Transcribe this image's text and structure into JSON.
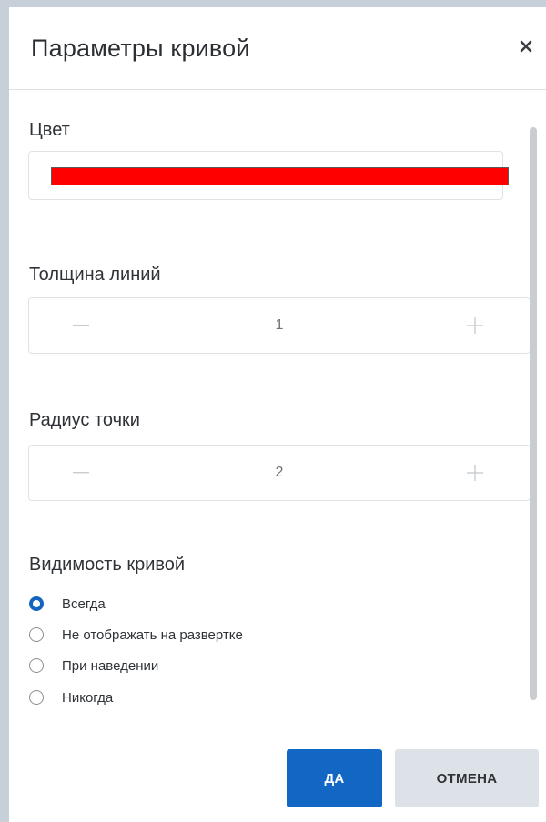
{
  "dialog": {
    "title": "Параметры кривой",
    "close_icon": "close-icon"
  },
  "color_section": {
    "label": "Цвет",
    "value": "#ff0000"
  },
  "line_width": {
    "label": "Толщина линий",
    "value": "1",
    "minus_icon": "minus-icon",
    "plus_icon": "plus-icon"
  },
  "point_radius": {
    "label": "Радиус точки",
    "value": "2",
    "minus_icon": "minus-icon",
    "plus_icon": "plus-icon"
  },
  "visibility": {
    "label": "Видимость кривой",
    "options": [
      {
        "label": "Всегда",
        "checked": true
      },
      {
        "label": "Не отображать на развертке",
        "checked": false
      },
      {
        "label": "При наведении",
        "checked": false
      },
      {
        "label": "Никогда",
        "checked": false
      }
    ]
  },
  "footer": {
    "ok_label": "ДА",
    "cancel_label": "ОТМЕНА"
  },
  "colors": {
    "accent": "#1266c4",
    "cancel_bg": "#dde2e8",
    "swatch": "#ff0000"
  }
}
